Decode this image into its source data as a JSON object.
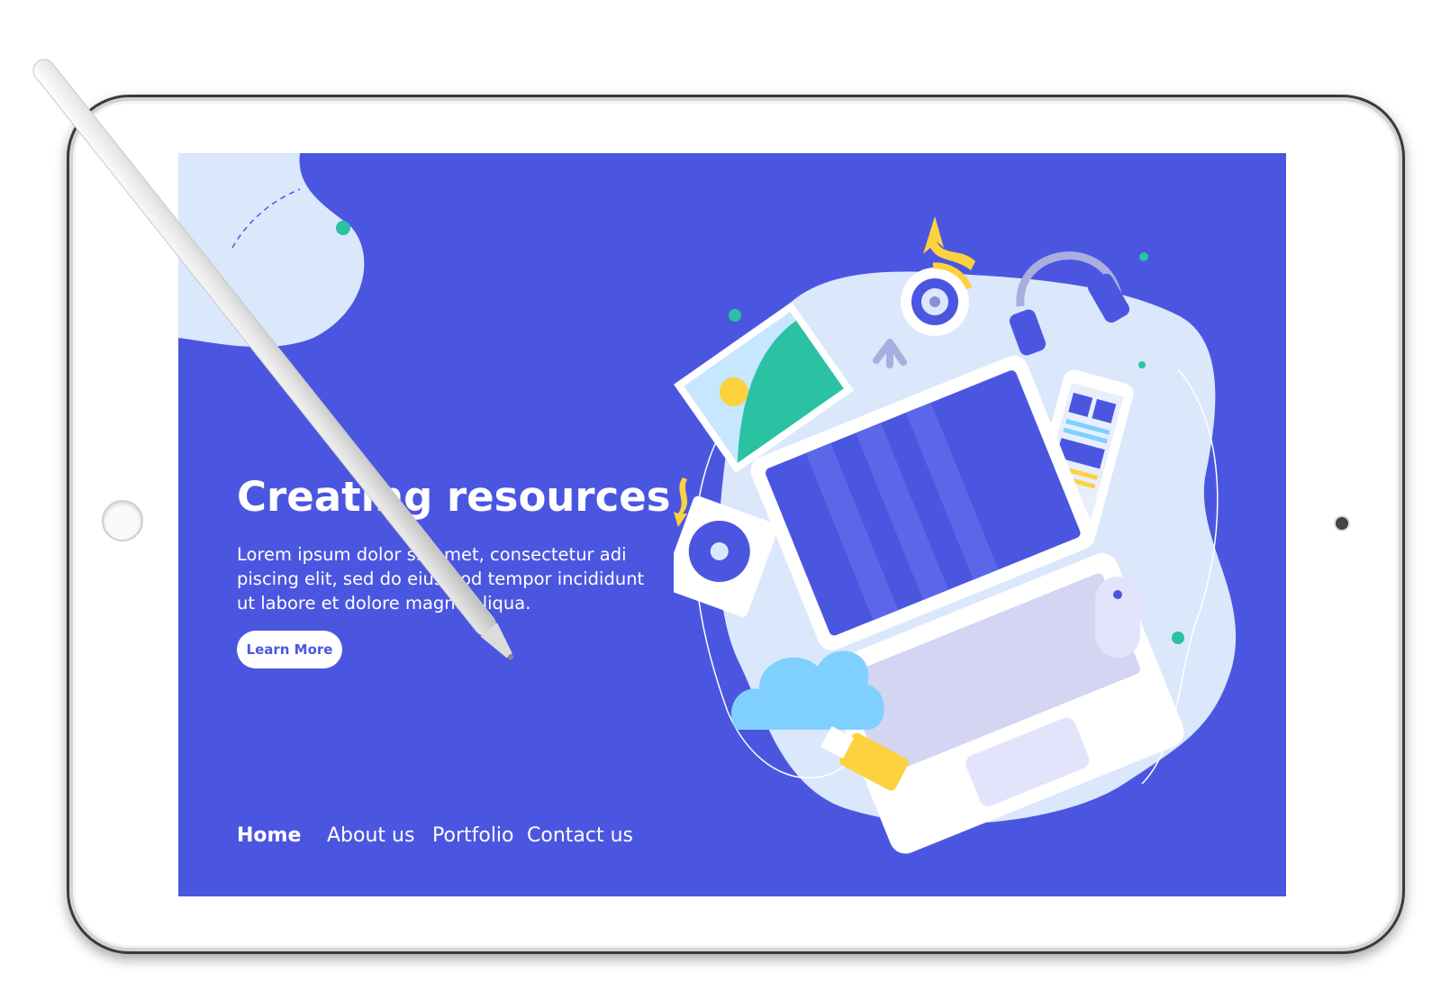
{
  "hero": {
    "title": "Creating resources",
    "body": "Lorem ipsum dolor sit amet, consectetur adi piscing elit, sed do eiusmod tempor incididunt ut labore et dolore magna aliqua.",
    "cta_label": "Learn More"
  },
  "nav": {
    "items": [
      {
        "label": "Home",
        "active": true
      },
      {
        "label": "About us",
        "active": false
      },
      {
        "label": "Portfolio",
        "active": false
      },
      {
        "label": "Contact us",
        "active": false
      }
    ]
  },
  "colors": {
    "background": "#4b56e0",
    "blob": "#dbe7fb",
    "accent_yellow": "#fcd23e",
    "accent_teal": "#2bc1a3",
    "cloud": "#7fd0ff"
  },
  "icons": [
    "laptop-icon",
    "headphones-icon",
    "webcam-icon",
    "phone-icon",
    "mouse-icon",
    "cloud-icon",
    "usb-drive-icon",
    "hard-drive-icon",
    "image-icon",
    "arrow-icon"
  ]
}
